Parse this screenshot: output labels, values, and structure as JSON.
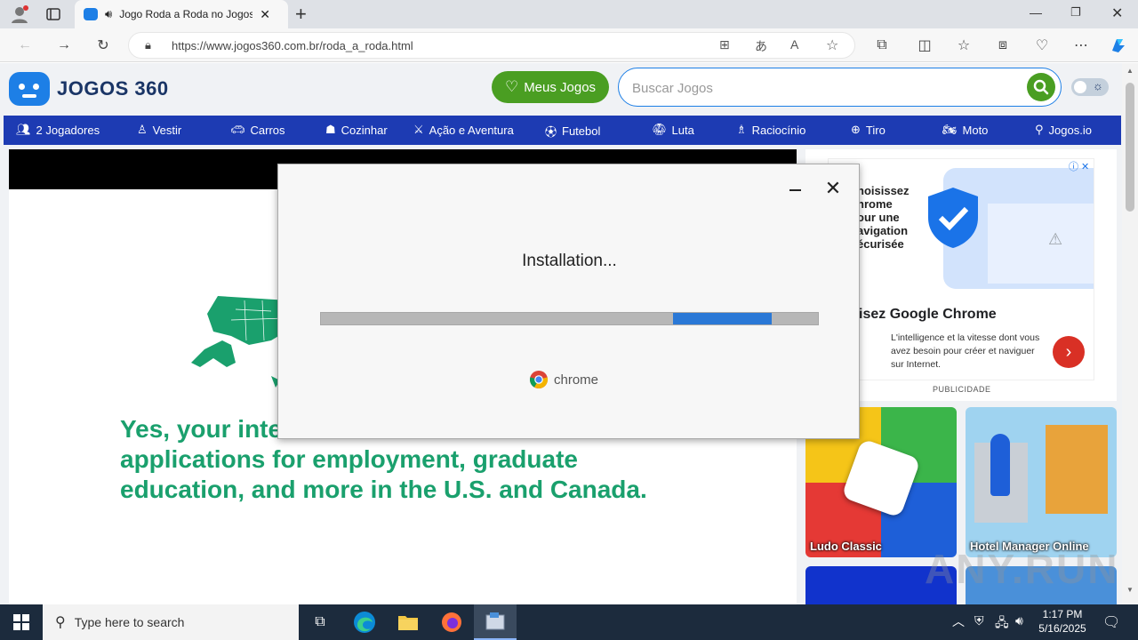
{
  "browser": {
    "tab_title": "Jogo Roda a Roda no Jogos",
    "url": "https://www.jogos360.com.br/roda_a_roda.html",
    "new_tab": "+"
  },
  "site": {
    "logo_text": "JOGOS 360",
    "meus_jogos_label": "Meus Jogos",
    "search_placeholder": "Buscar Jogos",
    "categories": [
      {
        "label": "2 Jogadores",
        "icon": "two-players-icon"
      },
      {
        "label": "Vestir",
        "icon": "dress-icon"
      },
      {
        "label": "Carros",
        "icon": "car-icon"
      },
      {
        "label": "Cozinhar",
        "icon": "chef-hat-icon"
      },
      {
        "label": "Ação e Aventura",
        "icon": "action-icon"
      },
      {
        "label": "Futebol",
        "icon": "soccer-ball-icon"
      },
      {
        "label": "Luta",
        "icon": "fight-icon"
      },
      {
        "label": "Raciocínio",
        "icon": "brain-icon"
      },
      {
        "label": "Tiro",
        "icon": "crosshair-icon"
      },
      {
        "label": "Moto",
        "icon": "motorcycle-icon"
      },
      {
        "label": "Jogos.io",
        "icon": "io-icon"
      }
    ]
  },
  "left_ad": {
    "text": "Yes, your inte                                                    applications for employment, graduate education, and more in the U.S. and Canada.",
    "line1": "Yes, your inte",
    "line2": "applications for employment, graduate",
    "line3": "education, and more in the U.S. and Canada."
  },
  "right_ad": {
    "promo_lines": [
      "hoisissez",
      "hrome",
      "our une",
      "avigation",
      "écurisée"
    ],
    "headline": "isez Google Chrome",
    "body": "L'intelligence et la vitesse dont vous avez besoin pour créer et naviguer sur Internet.",
    "label": "PUBLICIDADE"
  },
  "games": [
    {
      "name": "Ludo Classic"
    },
    {
      "name": "Hotel Manager Online"
    }
  ],
  "installer": {
    "title": "Installation...",
    "brand": "chrome",
    "progress_start": 0.708,
    "progress_end": 0.906,
    "accent": "#2a78d6"
  },
  "taskbar": {
    "search_placeholder": "Type here to search",
    "time": "1:17 PM",
    "date": "5/16/2025"
  },
  "watermark": "ANY.RUN"
}
